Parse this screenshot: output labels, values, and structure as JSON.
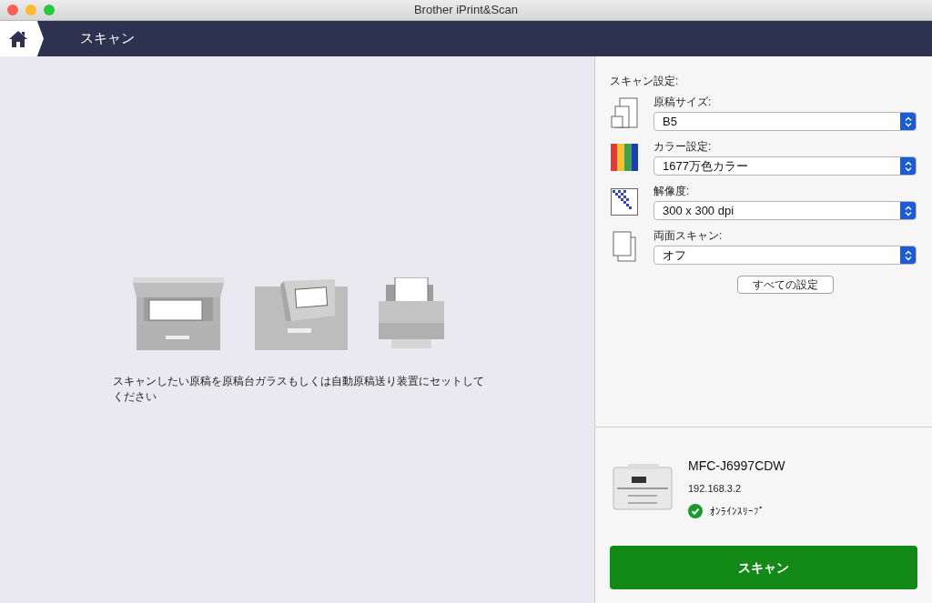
{
  "window": {
    "title": "Brother iPrint&Scan"
  },
  "nav": {
    "title": "スキャン"
  },
  "instruction": "スキャンしたい原稿を原稿台ガラスもしくは自動原稿送り装置にセットしてください",
  "settings": {
    "title": "スキャン設定:",
    "items": [
      {
        "kind": "paper-size",
        "label": "原稿サイズ:",
        "value": "B5"
      },
      {
        "kind": "color",
        "label": "カラー設定:",
        "value": "1677万色カラー"
      },
      {
        "kind": "resolution",
        "label": "解像度:",
        "value": "300 x 300 dpi"
      },
      {
        "kind": "duplex",
        "label": "両面スキャン:",
        "value": "オフ"
      }
    ],
    "all_button": "すべての設定"
  },
  "device": {
    "name": "MFC-J6997CDW",
    "address": "192.168.3.2",
    "online": true,
    "status": "ｵﾝﾗｲﾝｽﾘｰﾌﾟ"
  },
  "scan_button": "スキャン"
}
